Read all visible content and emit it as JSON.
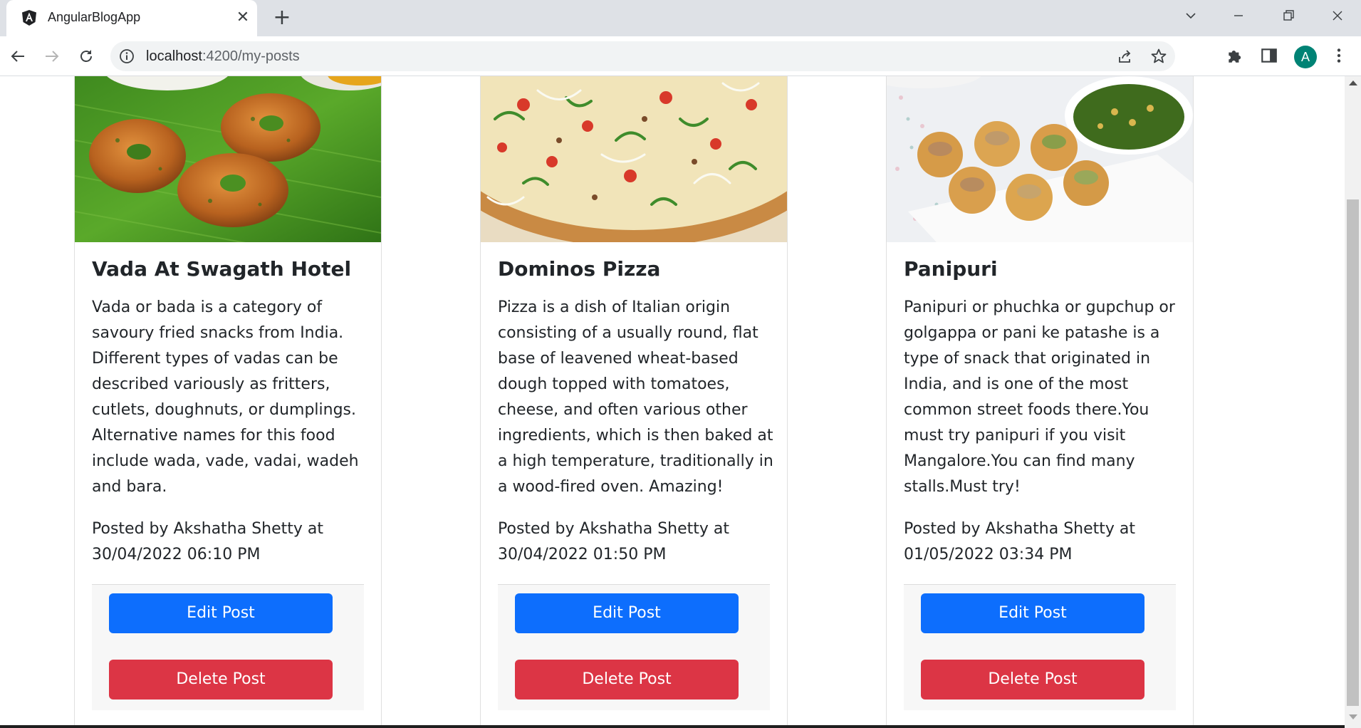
{
  "browser": {
    "tab_title": "AngularBlogApp",
    "url_host": "localhost",
    "url_path": ":4200/my-posts",
    "profile_initial": "A"
  },
  "posts": [
    {
      "title": "Vada At Swagath Hotel",
      "body": "Vada or bada is a category of savoury fried snacks from India. Different types of vadas can be described variously as fritters, cutlets, doughnuts, or dumplings. Alternative names for this food include wada, vade, vadai, wadeh and bara.",
      "meta": "Posted by Akshatha Shetty at 30/04/2022 06:10 PM",
      "edit_label": "Edit Post",
      "delete_label": "Delete Post"
    },
    {
      "title": "Dominos Pizza",
      "body": "Pizza is a dish of Italian origin consisting of a usually round, flat base of leavened wheat-based dough topped with tomatoes, cheese, and often various other ingredients, which is then baked at a high temperature, traditionally in a wood-fired oven. Amazing!",
      "meta": "Posted by Akshatha Shetty at 30/04/2022 01:50 PM",
      "edit_label": "Edit Post",
      "delete_label": "Delete Post"
    },
    {
      "title": "Panipuri",
      "body": "Panipuri or phuchka or gupchup or golgappa or pani ke patashe is a type of snack that originated in India, and is one of the most common street foods there.You must try panipuri if you visit Mangalore.You can find many stalls.Must try!",
      "meta": "Posted by Akshatha Shetty at 01/05/2022 03:34 PM",
      "edit_label": "Edit Post",
      "delete_label": "Delete Post"
    }
  ],
  "colors": {
    "edit": "#0d6efd",
    "delete": "#dc3545"
  }
}
